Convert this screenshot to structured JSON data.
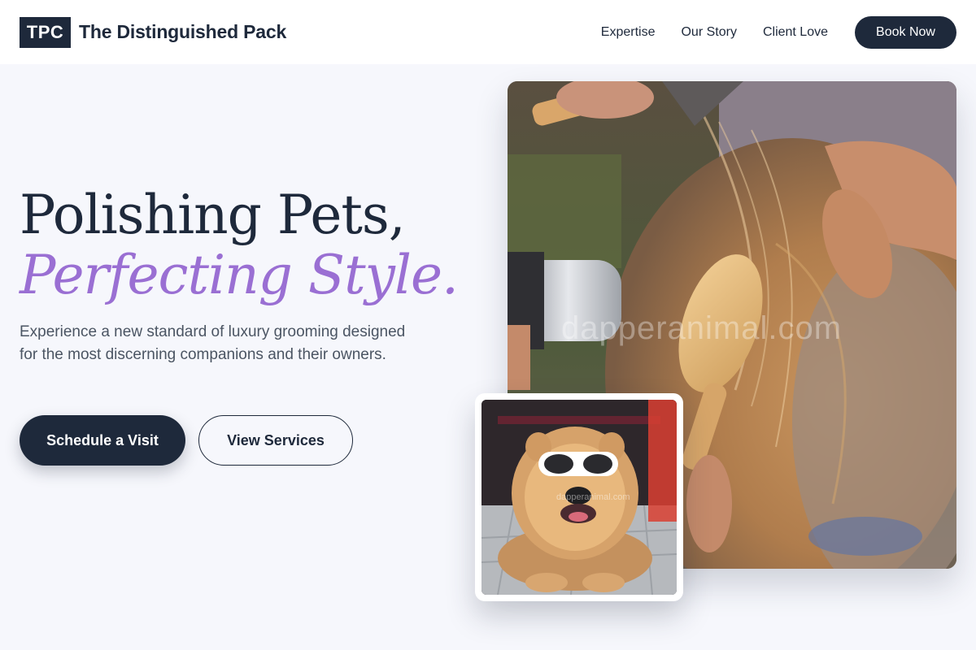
{
  "header": {
    "logo": "TPC",
    "brand_name": "The Distinguished Pack",
    "nav": [
      {
        "label": "Expertise"
      },
      {
        "label": "Our Story"
      },
      {
        "label": "Client Love"
      }
    ],
    "cta_label": "Book Now"
  },
  "hero": {
    "title_line1": "Polishing Pets,",
    "title_line2": "Perfecting Style.",
    "subtitle": "Experience a new standard of luxury grooming designed for the most discerning companions and their owners.",
    "primary_button": "Schedule a Visit",
    "secondary_button": "View Services"
  },
  "images": {
    "main_watermark": "dapperanimal.com",
    "inset_watermark": "dapperanimal.com"
  },
  "colors": {
    "navy": "#1e293b",
    "accent_purple": "#9a6fd3",
    "background": "#f6f7fc"
  }
}
